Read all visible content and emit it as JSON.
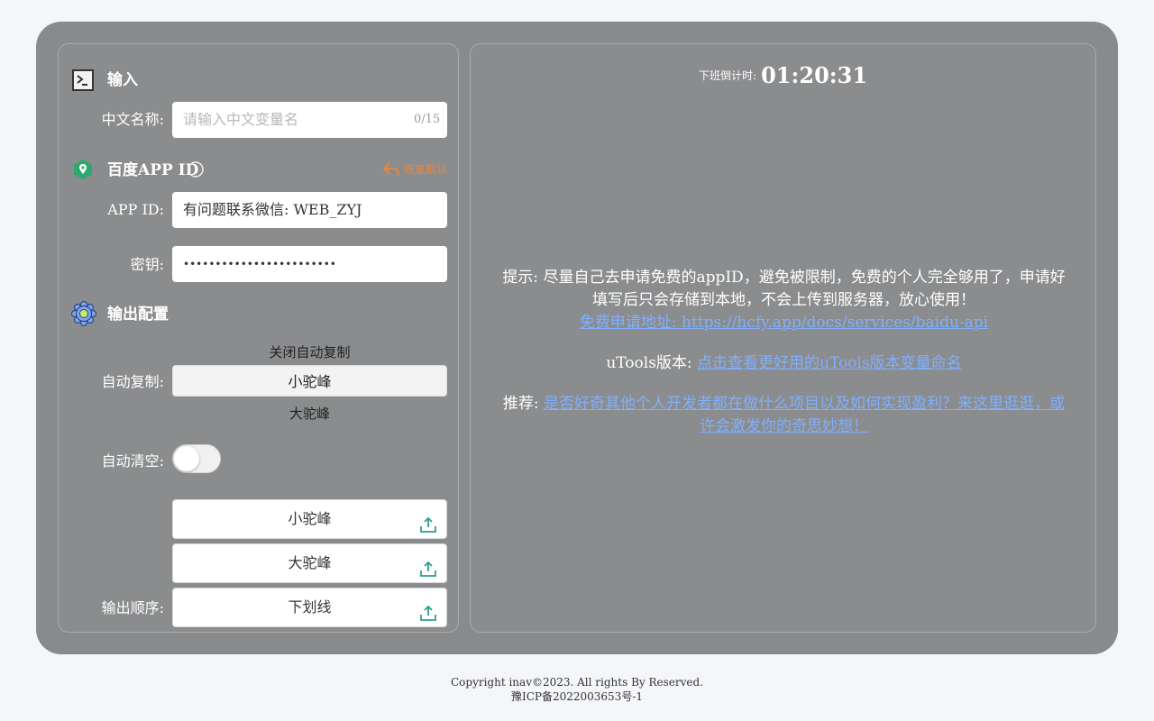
{
  "input_section": {
    "title": "输入",
    "chinese_name_label": "中文名称:",
    "chinese_name_placeholder": "请输入中文变量名",
    "chinese_name_value": "",
    "counter": "0/15"
  },
  "baidu_section": {
    "title": "百度APP ID",
    "restore_label": "恢复默认",
    "app_id_label": "APP ID:",
    "app_id_value": "有问题联系微信: WEB_ZYJ",
    "secret_label": "密钥:",
    "secret_value": "••••••••••••••••••••••••"
  },
  "output_section": {
    "title": "输出配置",
    "auto_copy_label": "自动复制:",
    "auto_copy_options": [
      "关闭自动复制",
      "小驼峰",
      "大驼峰"
    ],
    "auto_copy_selected": "小驼峰",
    "auto_clear_label": "自动清空:",
    "auto_clear_on": false,
    "order_label": "输出顺序:",
    "order_items": [
      "小驼峰",
      "大驼峰",
      "下划线"
    ]
  },
  "right": {
    "countdown_label": "下班倒计时:",
    "countdown_time": "01:20:31",
    "tip_text": "提示: 尽量自己去申请免费的appID，避免被限制，免费的个人完全够用了，申请好填写后只会存储到本地，不会上传到服务器，放心使用！",
    "tip_link": "免费申请地址: https://hcfy.app/docs/services/baidu-api",
    "utools_label": "uTools版本:",
    "utools_link": "点击查看更好用的uTools版本变量命名",
    "recommend_label": "推荐:",
    "recommend_link": "是否好奇其他个人开发者都在做什么项目以及如何实现盈利？来这里逛逛，或许会激发你的奇思妙想！"
  },
  "footer": {
    "copyright": "Copyright inav©2023. All rights By Reserved.",
    "icp": "豫ICP备2022003653号-1"
  },
  "colors": {
    "frame": "#898a8c",
    "link": "#7fb0ff",
    "restore": "#e8873a",
    "baidu_icon": "#2ea86f",
    "upload_icon": "#2f9e8c"
  }
}
